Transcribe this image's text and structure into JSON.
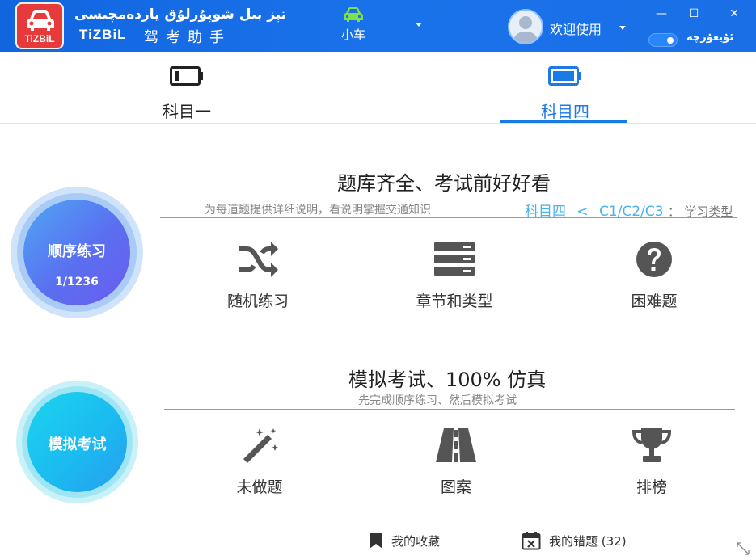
{
  "app": {
    "logo_text": "TiZBiL",
    "brand_uyghur": "تېز بىل شوپۇرلۇق ياردەمچىسى",
    "brand_english": "TiZBiL",
    "brand_chinese": "驾考助手"
  },
  "header": {
    "vehicle_label": "小车",
    "welcome_text": "欢迎使用",
    "minimize": "—",
    "maximize": "☐",
    "close": "✕",
    "toggle_label": "ئۇيغۇرچە",
    "toggle_on": true
  },
  "tabs": [
    {
      "label": "科目一",
      "active": false
    },
    {
      "label": "科目四",
      "active": true
    }
  ],
  "practice": {
    "circle_title": "顺序练习",
    "progress": "1/1236",
    "title": "题库齐全、考试前好好看",
    "description": "为每道题提供详细说明，看说明掌握交通知识",
    "crumb_subject": "科目四",
    "crumb_sep": "<",
    "crumb_license": "C1/C2/C3",
    "crumb_colon": "：",
    "crumb_type": "学习类型",
    "features": [
      {
        "label": "随机练习",
        "icon": "shuffle-icon"
      },
      {
        "label": "章节和类型",
        "icon": "server-list-icon"
      },
      {
        "label": "困难题",
        "icon": "question-circle-icon"
      }
    ]
  },
  "exam": {
    "circle_title": "模拟考试",
    "title": "模拟考试、100% 仿真",
    "description": "先完成顺序练习、然后模拟考试",
    "features": [
      {
        "label": "未做题",
        "icon": "magic-wand-icon"
      },
      {
        "label": "图案",
        "icon": "road-icon"
      },
      {
        "label": "排榜",
        "icon": "trophy-icon"
      }
    ]
  },
  "bottom": {
    "favorites": "我的收藏",
    "mistakes": "我的错题 (32)"
  },
  "colors": {
    "header_blue": "#1a6fe6",
    "accent_blue": "#1a7ae6",
    "crumb_blue": "#4ab2ee",
    "logo_red": "#e83a3a"
  }
}
